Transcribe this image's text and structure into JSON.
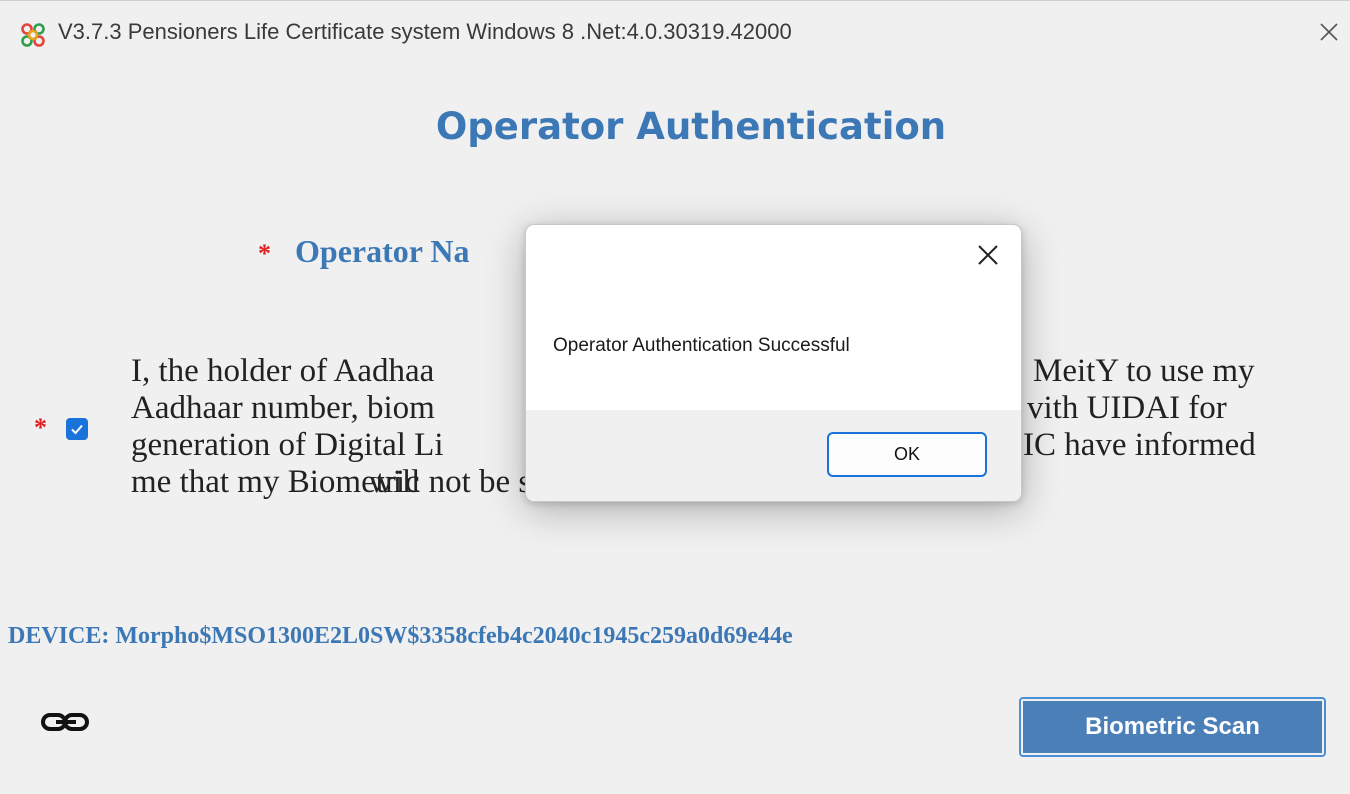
{
  "window": {
    "title": "V3.7.3 Pensioners Life Certificate system Windows 8 .Net:4.0.30319.42000",
    "close_icon": "close-icon"
  },
  "main": {
    "heading": "Operator Authentication",
    "operator_name_label": "Operator Na",
    "required_marker": "*",
    "consent_checked": true,
    "consent_lines": [
      "I, the holder of Aadhaa",
      "Aadhaar number, biom",
      "generation of Digital Li",
      "me that my Biometric",
      "MeitY to use my",
      "vith UIDAI for",
      "IC have informed",
      "will not be stored/shared."
    ],
    "device_label": "DEVICE: Morpho$MSO1300E2L0SW$3358cfeb4c2040c1945c259a0d69e44e",
    "link_icon": "link-icon",
    "biometric_button": "Biometric Scan"
  },
  "dialog": {
    "message": "Operator Authentication Successful",
    "ok_label": "OK",
    "close_icon": "close-icon"
  },
  "colors": {
    "accent_blue": "#3b78b5",
    "checkbox_blue": "#1a73d9",
    "required_red": "#e02020",
    "button_blue": "#4a7fb8"
  }
}
